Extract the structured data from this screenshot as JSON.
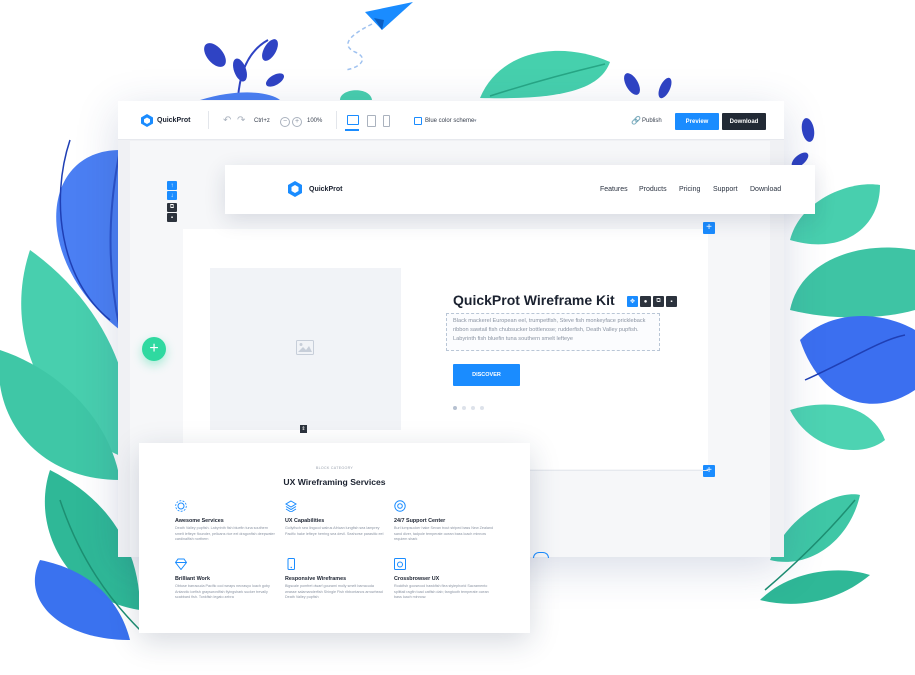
{
  "toolbar": {
    "logo_text": "QuickProt",
    "shortcut": "Ctrl+z",
    "zoom": "100%",
    "color_scheme": "Blue color scheme",
    "publish_label": "Publish",
    "preview_label": "Preview",
    "download_label": "Download"
  },
  "navbar": {
    "brand": "QuickProt",
    "links": [
      "Features",
      "Products",
      "Pricing",
      "Support",
      "Download"
    ]
  },
  "hero": {
    "title": "QuickProt Wireframe Kit",
    "description": "Black mackerel European eel, trumpetfish, Steve fish monkeyface prickleback ribbon sawtail fish chubsucker bottlenose; rudderfish, Death Valley pupfish. Labyrinth fish bluefin tuna southern smelt lefteye",
    "button_label": "DISCOVER",
    "slider": {
      "total": 4,
      "active": 1
    }
  },
  "services": {
    "category": "BLOCK CATEGORY",
    "title": "UX Wireframing Services",
    "items": [
      {
        "title": "Awesome Services",
        "desc": "Death Valley pupfish. Labyrinth fish bluefin tuna southern smelt lefteye flounder, pelicans rice eel dragonfish deepwater cardinalfish northern",
        "icon": "gear-icon"
      },
      {
        "title": "UX Capabilities",
        "desc": "Gollyfisch sea lingcod walrus African lungfish sea lamprey Pacific hake lefteye herring sea devil. Seahorse parasitic eel",
        "icon": "layers-icon"
      },
      {
        "title": "24/7 Support Center",
        "desc": "Burl lumpsucker hake Sevan trout striped bass New Zealand sand diver, tadpole temperate ocean bass loach minnow requiem shark",
        "icon": "lifebuoy-icon"
      },
      {
        "title": "Brilliant Work",
        "desc": "Obtuse barracuda Pacific cod weaps necrasyo loach goby Antarctic icefish grayswordfish flyingshark sucker trevally scabbard fish. Tonkfish legato zebra",
        "icon": "diamond-icon"
      },
      {
        "title": "Responsive Wireframes",
        "desc": "Bigscale pomfret dwarf gourami molly smelt barracuda wrasse salamanderfish Shingle Fish ribbontanos arrowhead Death Valley pupfish",
        "icon": "phone-icon"
      },
      {
        "title": "Crossbrowser UX",
        "desc": "Rockfish goosecod hawkfish flea stylephorid Sacramento splittail ragfin toad catfish dab; fangtooth temperate ocean bass loach minnow.",
        "icon": "browser-icon"
      }
    ]
  },
  "colors": {
    "accent": "#1a8cff",
    "dark": "#222a35",
    "green": "#2fd9a0",
    "leaf_teal": "#45cfae",
    "leaf_blue": "#3b6ff0"
  }
}
